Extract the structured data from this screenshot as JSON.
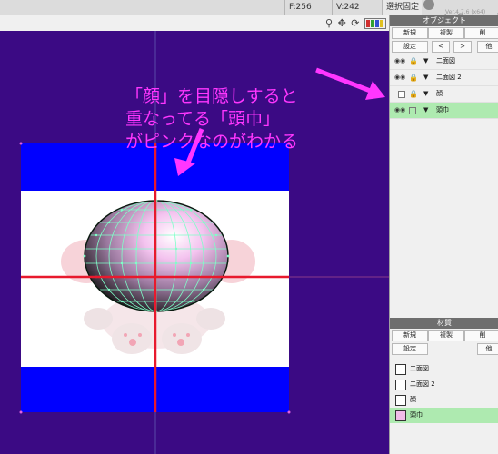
{
  "topbar": {
    "f_readout": "F:256",
    "v_readout": "V:242",
    "mode_label": "選択固定",
    "app_name": "metaSequoi",
    "app_version": "Ver.4.7.6 (x64)"
  },
  "view_tools": {
    "icons": [
      "magnifier-icon",
      "move-icon",
      "rotate-icon",
      "swatch-icon"
    ],
    "swatch_colors": [
      "#d03030",
      "#30a030",
      "#3050d0",
      "#e0c020"
    ]
  },
  "object_panel": {
    "title": "オブジェクト",
    "buttons_row1": [
      "新規",
      "複製",
      "削"
    ],
    "buttons_row2": [
      "設定",
      "<",
      ">",
      "他"
    ],
    "objects": [
      {
        "name": "二面図",
        "selected": false,
        "visible": true,
        "locked": true,
        "expanded": true
      },
      {
        "name": "二面図 2",
        "selected": false,
        "visible": true,
        "locked": true,
        "expanded": true
      },
      {
        "name": "顔",
        "selected": false,
        "visible": false,
        "locked": true,
        "expanded": true
      },
      {
        "name": "頭巾",
        "selected": true,
        "visible": true,
        "locked": false,
        "expanded": true
      }
    ]
  },
  "material_panel": {
    "title": "材質",
    "buttons_row1": [
      "新規",
      "複製",
      "削"
    ],
    "buttons_row2": [
      "設定",
      "他"
    ],
    "materials": [
      {
        "name": "二面図",
        "color": "#ffffff",
        "selected": false
      },
      {
        "name": "二面図 2",
        "color": "#ffffff",
        "selected": false
      },
      {
        "name": "顔",
        "color": "#ffffff",
        "selected": false
      },
      {
        "name": "頭巾",
        "color": "#f1bde8",
        "selected": true
      }
    ]
  },
  "annotation": {
    "lines": [
      "「顔」を目隠しすると",
      "重なってる「頭巾」",
      "がピンクなのがわかる"
    ],
    "color": "#ff36ff"
  },
  "viewport": {
    "background": "#3b0a84",
    "guide_color": "#e8192d",
    "mesh_color": "#7fffc8"
  }
}
